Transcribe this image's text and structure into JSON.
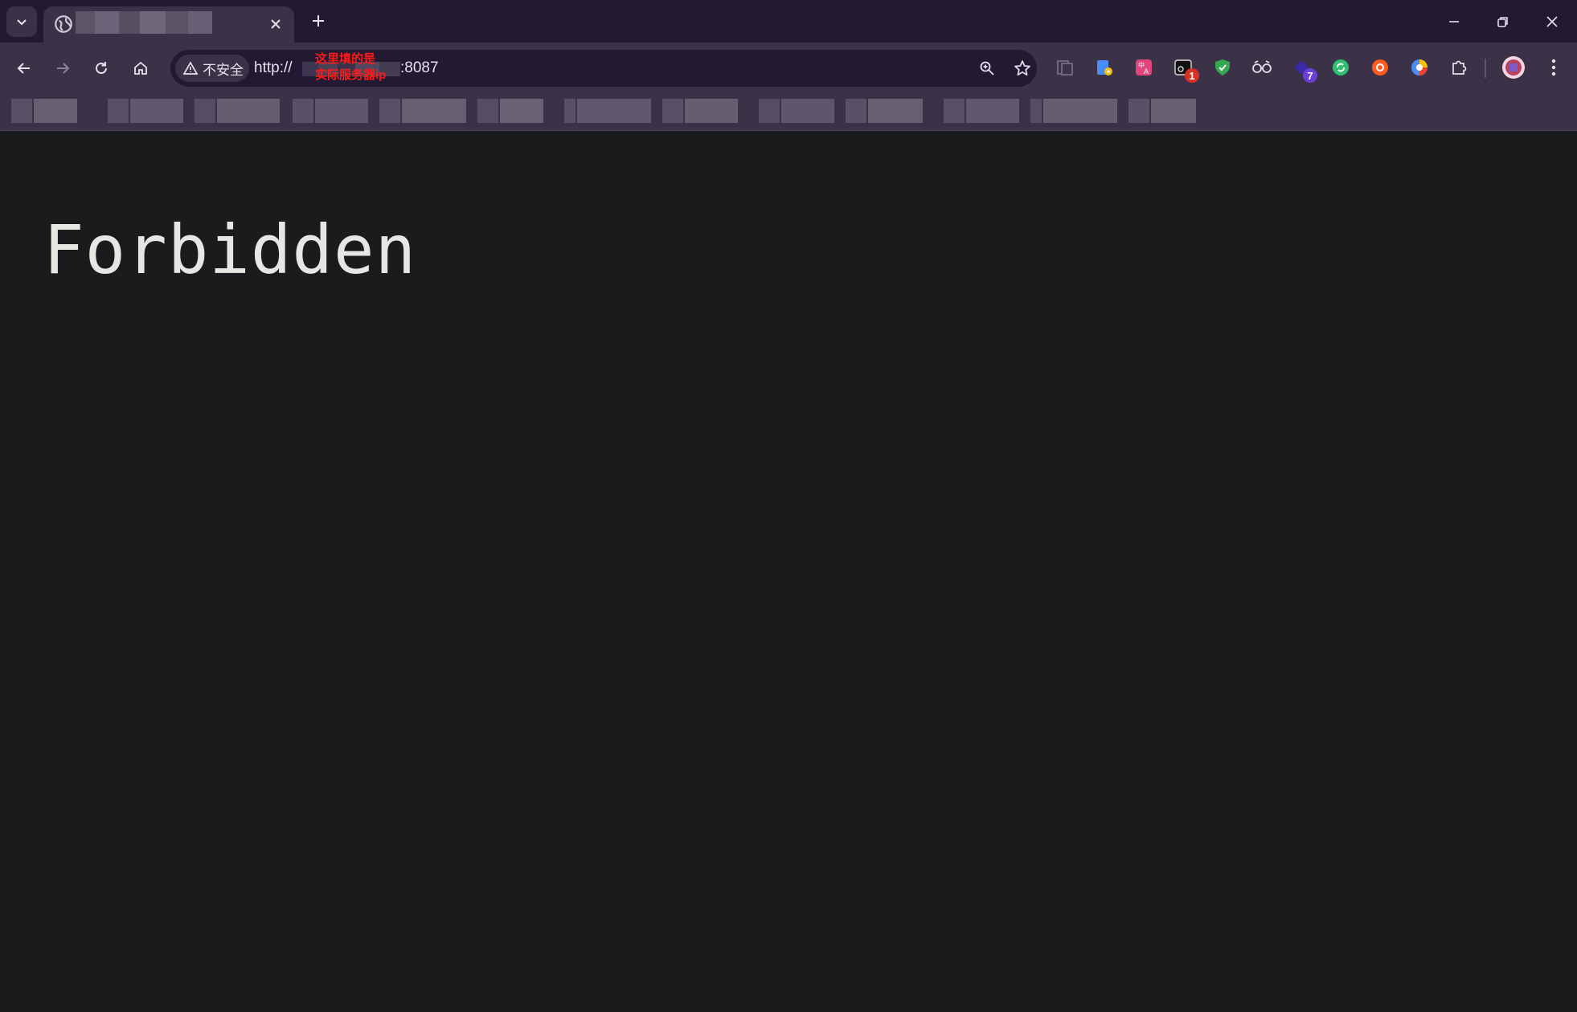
{
  "browser": {
    "tab": {
      "favicon": "globe-icon",
      "close_icon": "close-icon"
    },
    "window_controls": [
      "minimize-icon",
      "restore-icon",
      "close-icon"
    ],
    "toolbar": {
      "security_chip_label": "不安全",
      "url_scheme": "http://",
      "url_port": ":8087",
      "annotation_line1": "这里填的是",
      "annotation_line2": "实际服务器ip"
    },
    "extensions": [
      {
        "icon": "reading-list-icon"
      },
      {
        "icon": "translate-doc-icon"
      },
      {
        "icon": "translate-icon",
        "color": "#e0457b"
      },
      {
        "icon": "screenshot-extension-icon",
        "badge": "1",
        "badge_color": "#d93025"
      },
      {
        "icon": "shield-check-icon",
        "color": "#34a853"
      },
      {
        "icon": "glasses-icon"
      },
      {
        "icon": "purple-extension-icon",
        "badge": "7",
        "badge_color": "#6b3fd6"
      },
      {
        "icon": "green-refresh-icon",
        "color": "#2fbf71"
      },
      {
        "icon": "orange-extension-icon",
        "color": "#ff5a1f"
      },
      {
        "icon": "colorful-circle-icon"
      },
      {
        "icon": "puzzle-icon"
      }
    ]
  },
  "page": {
    "heading": "Forbidden"
  }
}
